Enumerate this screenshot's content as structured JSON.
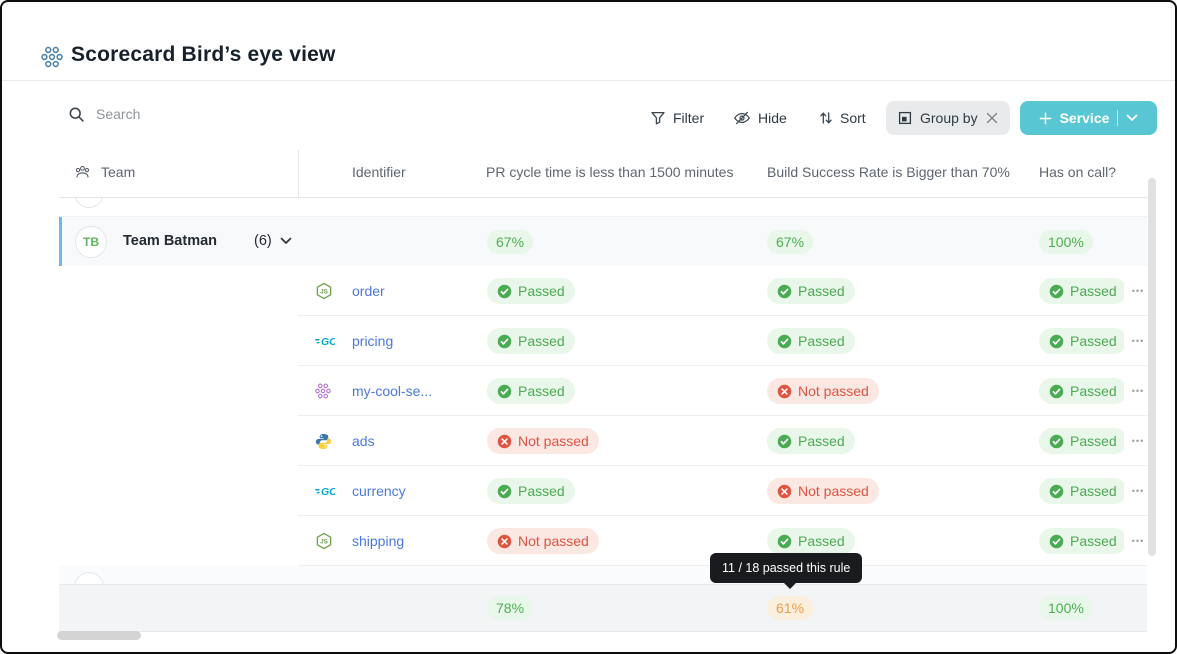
{
  "window": {
    "title": "Scorecard Bird’s eye view"
  },
  "toolbar": {
    "search_placeholder": "Search",
    "filter": "Filter",
    "hide": "Hide",
    "sort": "Sort",
    "group_by": "Group by",
    "service": "Service"
  },
  "columns": {
    "team": "Team",
    "identifier": "Identifier",
    "pr": "PR cycle time is less than 1500 minutes",
    "build": "Build Success Rate is Bigger than 70%",
    "oncall": "Has on call?"
  },
  "group": {
    "initials": "TB",
    "name": "Team Batman",
    "count": "(6)",
    "summary": {
      "pr": "67%",
      "build": "67%",
      "oncall": "100%"
    }
  },
  "rows": [
    {
      "identifier": "order",
      "icon": "nodejs-icon",
      "pr": "Passed",
      "build": "Passed",
      "oncall": "Passed"
    },
    {
      "identifier": "pricing",
      "icon": "go-icon",
      "pr": "Passed",
      "build": "Passed",
      "oncall": "Passed"
    },
    {
      "identifier": "my-cool-se...",
      "icon": "service-cluster-icon",
      "pr": "Passed",
      "build": "Not passed",
      "oncall": "Passed"
    },
    {
      "identifier": "ads",
      "icon": "python-icon",
      "pr": "Not passed",
      "build": "Passed",
      "oncall": "Passed"
    },
    {
      "identifier": "currency",
      "icon": "go-icon",
      "pr": "Passed",
      "build": "Not passed",
      "oncall": "Passed"
    },
    {
      "identifier": "shipping",
      "icon": "nodejs-icon",
      "pr": "Not passed",
      "build": "Passed",
      "oncall": "Passed"
    }
  ],
  "footer_summary": {
    "pr": "78%",
    "build": "61%",
    "oncall": "100%"
  },
  "tooltip": "11 / 18 passed this rule",
  "colors": {
    "accent_teal": "#59c7d3",
    "passed_green": "#4aab52",
    "failed_red": "#de5540",
    "warning_orange": "#eb9d4c",
    "link_blue": "#4a78e0",
    "team_accent_blue": "#77b5e8",
    "scorecard_icon_blue": "#4a81aa"
  }
}
